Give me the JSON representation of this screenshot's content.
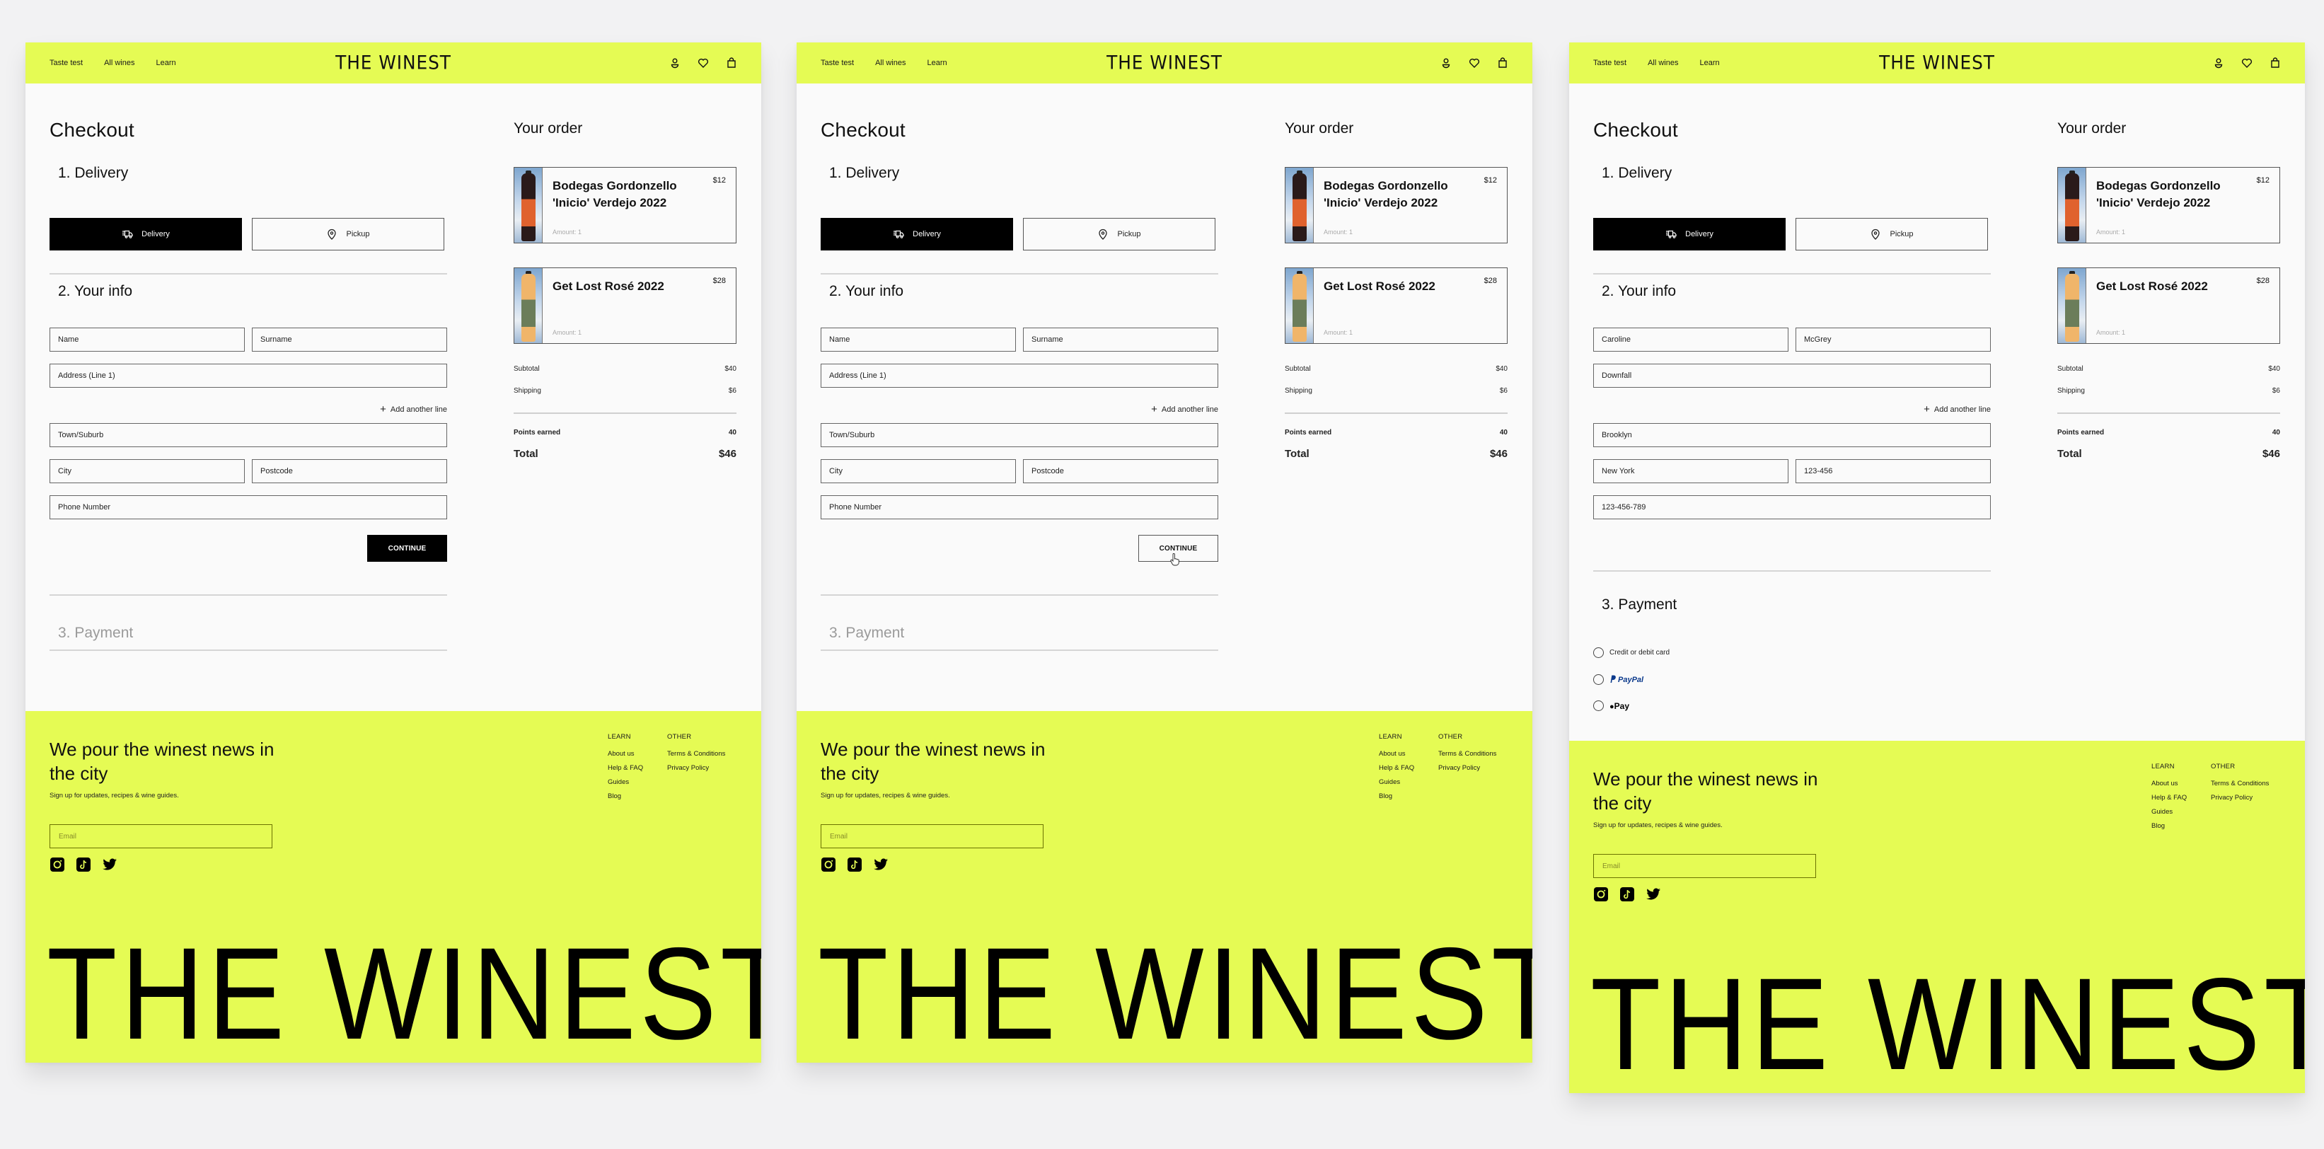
{
  "brand": {
    "logo": "THE WINEST",
    "accent_color": "#e5fb54",
    "nav": [
      "Taste test",
      "All wines",
      "Learn"
    ],
    "icons": [
      "user-icon",
      "heart-icon",
      "bag-icon"
    ]
  },
  "checkout": {
    "title": "Checkout",
    "sections": {
      "delivery": "1. Delivery",
      "info": "2. Your info",
      "payment": "3. Payment"
    },
    "delivery_options": [
      "Delivery",
      "Pickup"
    ],
    "add_line_label": "Add another line",
    "continue_label": "CONTINUE",
    "payment_options": {
      "card": "Credit or debit card",
      "paypal": "PayPal",
      "applepay": "Pay"
    }
  },
  "placeholders": {
    "name": "Name",
    "surname": "Surname",
    "address": "Address (Line 1)",
    "town": "Town/Suburb",
    "city": "City",
    "postcode": "Postcode",
    "phone": "Phone Number"
  },
  "screens": [
    {
      "state": "empty-form",
      "continue_style": "filled",
      "values": {
        "name": "Name",
        "surname": "Surname",
        "address": "Address (Line 1)",
        "town": "Town/Suburb",
        "city": "City",
        "postcode": "Postcode",
        "phone": "Phone Number"
      }
    },
    {
      "state": "continue-hover",
      "continue_style": "outline",
      "values": {
        "name": "Name",
        "surname": "Surname",
        "address": "Address (Line 1)",
        "town": "Town/Suburb",
        "city": "City",
        "postcode": "Postcode",
        "phone": "Phone Number"
      }
    },
    {
      "state": "payment-expanded",
      "values": {
        "name": "Caroline",
        "surname": "McGrey",
        "address": "Downfall",
        "town": "Brooklyn",
        "city": "New York",
        "postcode": "123-456",
        "phone": "123-456-789"
      }
    }
  ],
  "order": {
    "title": "Your order",
    "items": [
      {
        "name": "Bodegas Gordonzello 'Inicio' Verdejo 2022",
        "price": "$12",
        "amount": "Amount: 1",
        "bottle_color": "#2a1a1a",
        "label_color": "#e0622e"
      },
      {
        "name": "Get Lost Rosé 2022",
        "price": "$28",
        "amount": "Amount: 1",
        "bottle_color": "#f0b56a",
        "label_color": "#6b7d5a"
      }
    ],
    "subtotal_label": "Subtotal",
    "subtotal": "$40",
    "shipping_label": "Shipping",
    "shipping": "$6",
    "points_label": "Points earned",
    "points": "40",
    "total_label": "Total",
    "total": "$46"
  },
  "footer": {
    "headline": "We pour the winest news in the city",
    "subtext": "Sign up for updates, recipes & wine guides.",
    "email_placeholder": "Email",
    "social": [
      "instagram-icon",
      "tiktok-icon",
      "twitter-icon"
    ],
    "columns": [
      {
        "heading": "LEARN",
        "links": [
          "About us",
          "Help & FAQ",
          "Guides",
          "Blog"
        ]
      },
      {
        "heading": "OTHER",
        "links": [
          "Terms & Conditions",
          "Privacy Policy"
        ]
      }
    ],
    "big_logo": "THE WINEST"
  }
}
